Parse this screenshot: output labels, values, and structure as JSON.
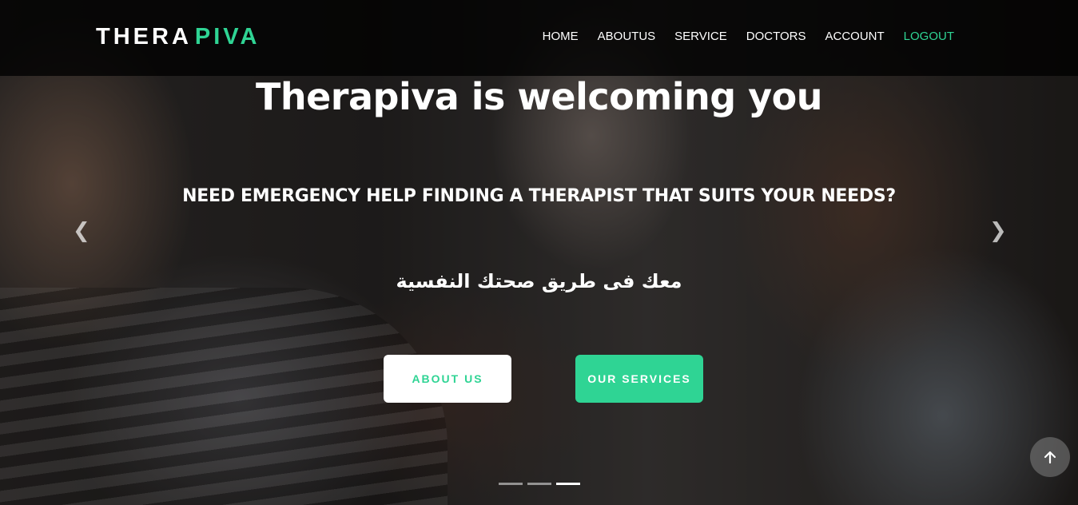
{
  "brand": {
    "part1": "THERA",
    "part2": "PIVA",
    "accent_color": "#2fd494"
  },
  "nav": {
    "items": [
      {
        "label": "HOME",
        "active": false
      },
      {
        "label": "ABOUTUS",
        "active": false
      },
      {
        "label": "SERVICE",
        "active": false
      },
      {
        "label": "DOCTORS",
        "active": false
      },
      {
        "label": "ACCOUNT",
        "active": false
      },
      {
        "label": "LOGOUT",
        "active": true
      }
    ]
  },
  "hero": {
    "headline": "Therapiva is welcoming you",
    "subline": "NEED EMERGENCY HELP FINDING A THERAPIST THAT SUITS YOUR NEEDS?",
    "arabic": "معك فى طريق صحتك النفسية",
    "about_button": "ABOUT US",
    "services_button": "OUR SERVICES"
  },
  "carousel": {
    "prev_icon": "chevron-left-icon",
    "next_icon": "chevron-right-icon",
    "slide_count": 3,
    "active_slide": 3
  },
  "scroll_top_icon": "arrow-up-icon"
}
